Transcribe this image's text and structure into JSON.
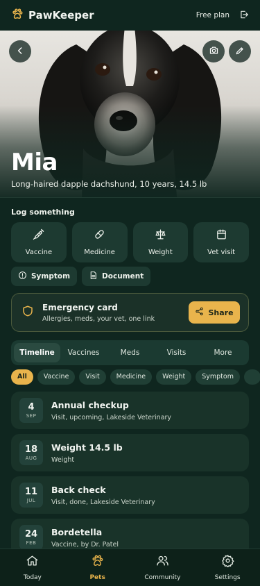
{
  "app": {
    "name": "PawKeeper",
    "plan_label": "Free plan"
  },
  "colors": {
    "accent": "#e9b44c",
    "background": "#0f261f",
    "card": "#1d3a31"
  },
  "pet": {
    "name": "Mia",
    "description": "Long-haired dapple dachshund, 10 years, 14.5 lb"
  },
  "log": {
    "title": "Log something",
    "actions": [
      {
        "label": "Vaccine",
        "icon": "syringe-icon"
      },
      {
        "label": "Medicine",
        "icon": "pill-icon"
      },
      {
        "label": "Weight",
        "icon": "scale-icon"
      },
      {
        "label": "Vet visit",
        "icon": "calendar-icon"
      }
    ],
    "secondary": [
      {
        "label": "Symptom",
        "icon": "alert-circle-icon"
      },
      {
        "label": "Document",
        "icon": "document-icon"
      }
    ]
  },
  "emergency": {
    "title": "Emergency card",
    "subtitle": "Allergies, meds, your vet, one link",
    "share_label": "Share"
  },
  "tabs": [
    "Timeline",
    "Vaccines",
    "Meds",
    "Visits",
    "More"
  ],
  "active_tab": "Timeline",
  "filters": [
    "All",
    "Vaccine",
    "Visit",
    "Medicine",
    "Weight",
    "Symptom"
  ],
  "active_filter": "All",
  "events": [
    {
      "day": "4",
      "month": "SEP",
      "title": "Annual checkup",
      "subtitle": "Visit, upcoming, Lakeside Veterinary"
    },
    {
      "day": "18",
      "month": "AUG",
      "title": "Weight 14.5 lb",
      "subtitle": "Weight"
    },
    {
      "day": "11",
      "month": "JUL",
      "title": "Back check",
      "subtitle": "Visit, done, Lakeside Veterinary"
    },
    {
      "day": "24",
      "month": "FEB",
      "title": "Bordetella",
      "subtitle": "Vaccine, by Dr. Patel"
    }
  ],
  "nav": [
    {
      "label": "Today",
      "icon": "home-icon"
    },
    {
      "label": "Pets",
      "icon": "paw-icon",
      "active": true
    },
    {
      "label": "Community",
      "icon": "users-icon"
    },
    {
      "label": "Settings",
      "icon": "gear-icon"
    }
  ]
}
